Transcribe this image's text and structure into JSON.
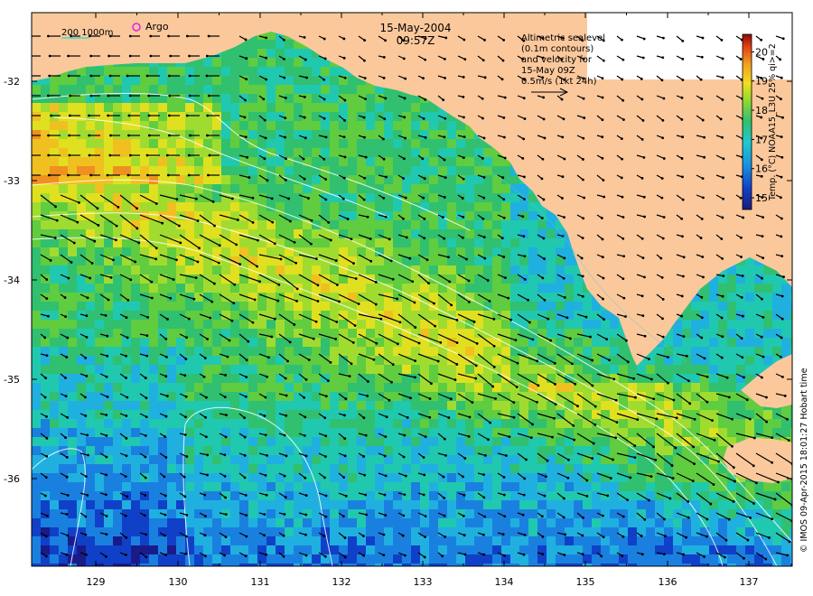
{
  "title": {
    "date": "15-May-2004",
    "time": "09:57Z"
  },
  "legend": {
    "bathymetry_label": "200 1000m",
    "argo_label": "Argo"
  },
  "velocity_note": {
    "lines": [
      "Altimetric sealevel",
      "(0.1m contours)",
      "and velocity for",
      "15-May 09Z",
      "0.5m/s (1kt 24h)"
    ]
  },
  "colorbar": {
    "label": "Temp. (°C) NOAA15_L3U 25% qi>=2",
    "ticks": [
      "20",
      "19",
      "18",
      "17",
      "16",
      "15"
    ],
    "range": [
      14.6,
      20.6
    ]
  },
  "axes": {
    "x_ticks": [
      "129",
      "130",
      "131",
      "132",
      "133",
      "134",
      "135",
      "136",
      "137"
    ],
    "y_ticks": [
      "-32",
      "-33",
      "-34",
      "-35",
      "-36"
    ]
  },
  "credit": "© IMOS 09-Apr-2015 18:01:27 Hobart time",
  "colors": {
    "land": "#fbc89c",
    "contour": "#ffffff",
    "bathymetry": "#40d8c8",
    "argo": "#e020e0",
    "arrow": "#000000"
  }
}
